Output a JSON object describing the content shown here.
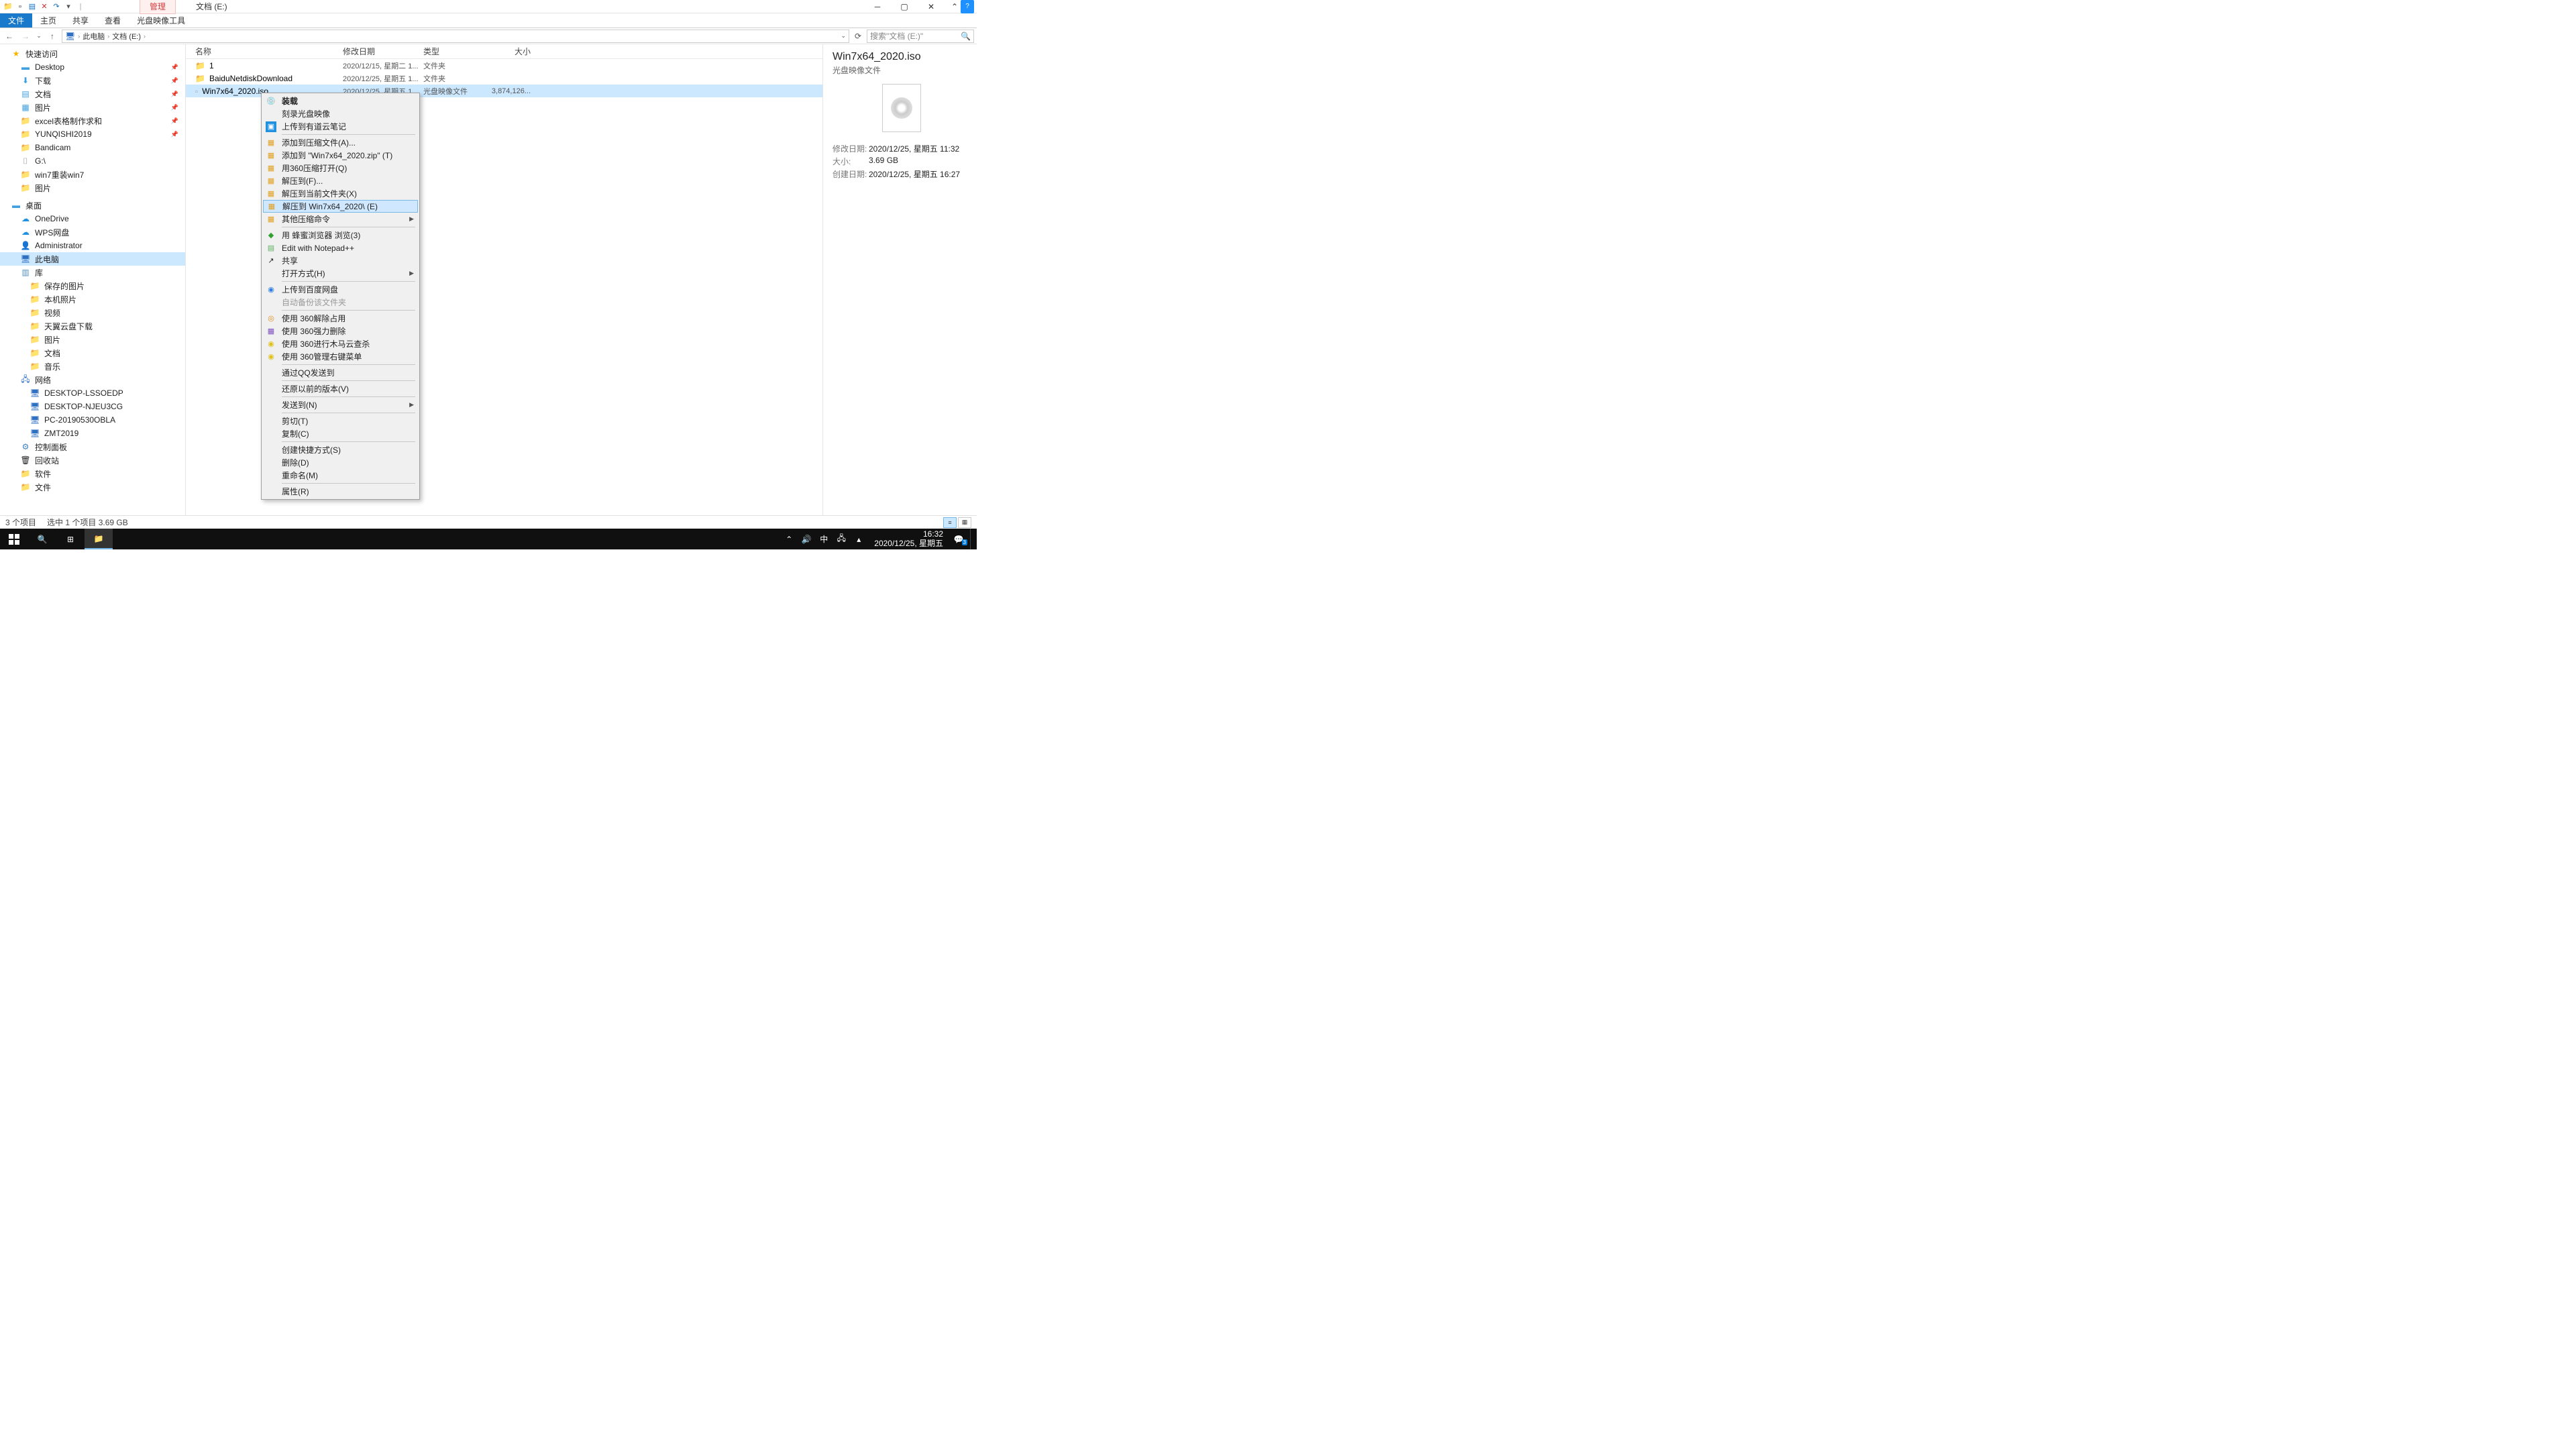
{
  "titlebar": {
    "manage_tab": "管理",
    "title": "文档 (E:)"
  },
  "ribbon": {
    "file": "文件",
    "home": "主页",
    "share": "共享",
    "view": "查看",
    "disc_tools": "光盘映像工具"
  },
  "address": {
    "root": "此电脑",
    "drive": "文档 (E:)",
    "search_placeholder": "搜索\"文档 (E:)\""
  },
  "tree": {
    "quick": "快速访问",
    "desktop": "Desktop",
    "downloads": "下载",
    "documents": "文档",
    "pictures": "图片",
    "excel": "excel表格制作求和",
    "yunqishi": "YUNQISHI2019",
    "bandicam": "Bandicam",
    "gdrive": "G:\\",
    "win7reinstall": "win7重装win7",
    "pictures2": "图片",
    "desktop_cn": "桌面",
    "onedrive": "OneDrive",
    "wps": "WPS网盘",
    "admin": "Administrator",
    "thispc": "此电脑",
    "library": "库",
    "saved_pics": "保存的图片",
    "local_photos": "本机照片",
    "videos": "视频",
    "tianyi": "天翼云盘下载",
    "pics3": "图片",
    "docs3": "文档",
    "music": "音乐",
    "network": "网络",
    "pc1": "DESKTOP-LSSOEDP",
    "pc2": "DESKTOP-NJEU3CG",
    "pc3": "PC-20190530OBLA",
    "pc4": "ZMT2019",
    "ctrlpanel": "控制面板",
    "recycle": "回收站",
    "software": "软件",
    "files": "文件"
  },
  "columns": {
    "name": "名称",
    "date": "修改日期",
    "type": "类型",
    "size": "大小"
  },
  "files": [
    {
      "name": "1",
      "date": "2020/12/15, 星期二 1...",
      "type": "文件夹",
      "size": "",
      "icon": "folder"
    },
    {
      "name": "BaiduNetdiskDownload",
      "date": "2020/12/25, 星期五 1...",
      "type": "文件夹",
      "size": "",
      "icon": "folder"
    },
    {
      "name": "Win7x64_2020.iso",
      "date": "2020/12/25, 星期五 1...",
      "type": "光盘映像文件",
      "size": "3,874,126...",
      "icon": "disc",
      "selected": true
    }
  ],
  "ctx": {
    "mount": "装载",
    "burn": "刻录光盘映像",
    "youdao": "上传到有道云笔记",
    "addarchive": "添加到压缩文件(A)...",
    "addzip": "添加到 \"Win7x64_2020.zip\" (T)",
    "open360": "用360压缩打开(Q)",
    "extractto": "解压到(F)...",
    "extracthere": "解压到当前文件夹(X)",
    "extractfolder": "解压到 Win7x64_2020\\ (E)",
    "othercompress": "其他压缩命令",
    "bee": "用 蜂蜜浏览器 浏览(3)",
    "npp": "Edit with Notepad++",
    "share": "共享",
    "openwith": "打开方式(H)",
    "baidu": "上传到百度网盘",
    "autobackup": "自动备份该文件夹",
    "unlock360": "使用 360解除占用",
    "forcedel": "使用 360强力删除",
    "trojan": "使用 360进行木马云查杀",
    "manage360": "使用 360管理右键菜单",
    "qqsend": "通过QQ发送到",
    "restore": "还原以前的版本(V)",
    "sendto": "发送到(N)",
    "cut": "剪切(T)",
    "copy": "复制(C)",
    "shortcut": "创建快捷方式(S)",
    "delete": "删除(D)",
    "rename": "重命名(M)",
    "props": "属性(R)"
  },
  "details": {
    "title": "Win7x64_2020.iso",
    "subtitle": "光盘映像文件",
    "mod_label": "修改日期:",
    "mod_val": "2020/12/25, 星期五 11:32",
    "size_label": "大小:",
    "size_val": "3.69 GB",
    "create_label": "创建日期:",
    "create_val": "2020/12/25, 星期五 16:27"
  },
  "status": {
    "items": "3 个项目",
    "selected": "选中 1 个项目  3.69 GB"
  },
  "taskbar": {
    "time": "16:32",
    "date": "2020/12/25, 星期五",
    "ime": "中",
    "badge": "3"
  }
}
